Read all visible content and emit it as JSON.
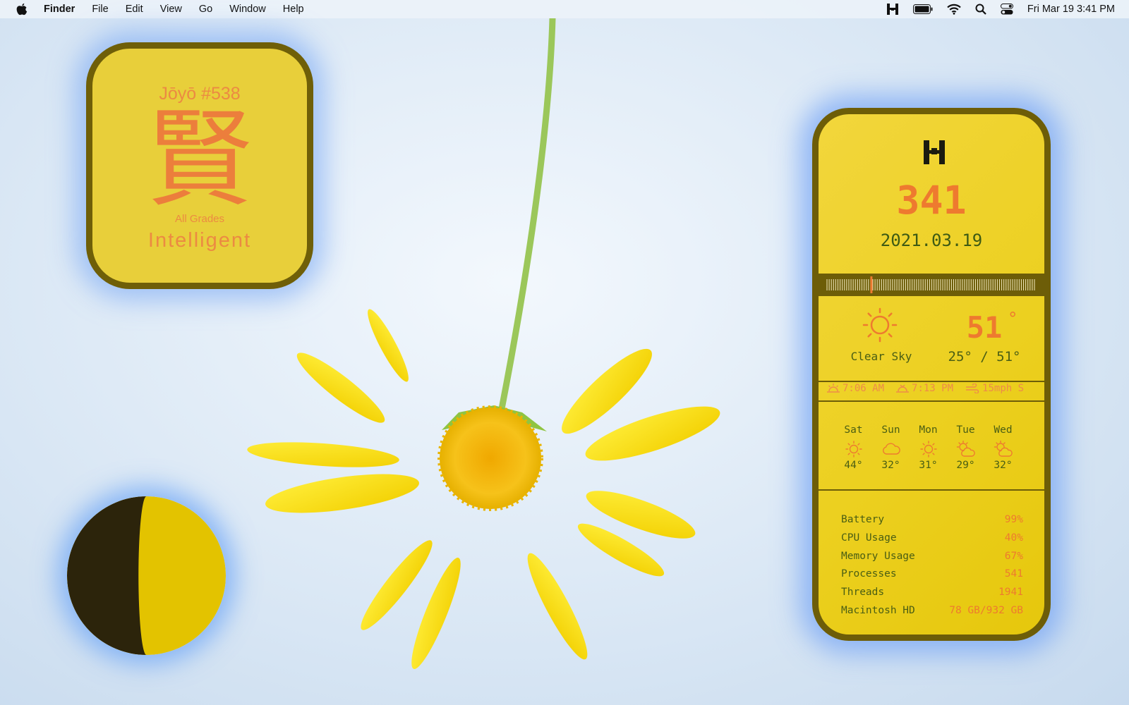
{
  "menubar": {
    "app_name": "Finder",
    "menus": [
      "File",
      "Edit",
      "View",
      "Go",
      "Window",
      "Help"
    ],
    "status_icons": [
      "hyperspace-icon",
      "battery-icon",
      "wifi-icon",
      "search-icon",
      "control-center-icon"
    ],
    "clock": "Fri Mar 19  3:41 PM"
  },
  "kanji_widget": {
    "number": "Jōyō #538",
    "character": "賢",
    "grade": "All Grades",
    "meaning": "Intelligent"
  },
  "moon_widget": {
    "phase_name": "moon-phase",
    "lit_fraction": 0.45,
    "lit_color": "#e3c300",
    "dark_color": "#2c240b"
  },
  "panel": {
    "day_of_year": "341",
    "date": "2021.03.19",
    "year_progress": 0.214,
    "weather": {
      "icon": "sun-icon",
      "condition": "Clear Sky",
      "temperature": "51",
      "degree_symbol": "°",
      "range": "25° / 51°"
    },
    "sun_info": {
      "sunrise": "7:06 AM",
      "sunset": "7:13 PM",
      "wind": "15mph S"
    },
    "forecast": [
      {
        "day": "Sat",
        "icon": "sun-icon",
        "temp": "44°"
      },
      {
        "day": "Sun",
        "icon": "cloud-icon",
        "temp": "32°"
      },
      {
        "day": "Mon",
        "icon": "sun-icon",
        "temp": "31°"
      },
      {
        "day": "Tue",
        "icon": "partly-cloudy-icon",
        "temp": "29°"
      },
      {
        "day": "Wed",
        "icon": "partly-cloudy-icon",
        "temp": "32°"
      }
    ],
    "stats": [
      {
        "label": "Battery",
        "value": "99%"
      },
      {
        "label": "CPU Usage",
        "value": "40%"
      },
      {
        "label": "Memory Usage",
        "value": "67%"
      },
      {
        "label": "Processes",
        "value": "541"
      },
      {
        "label": "Threads",
        "value": "1941"
      },
      {
        "label": "Macintosh HD",
        "value": "78 GB/932 GB"
      }
    ]
  },
  "colors": {
    "accent_orange": "#ee7a2f",
    "panel_yellow": "#ecd020",
    "panel_border": "#6d5d08",
    "text_green": "#4a5e14"
  }
}
